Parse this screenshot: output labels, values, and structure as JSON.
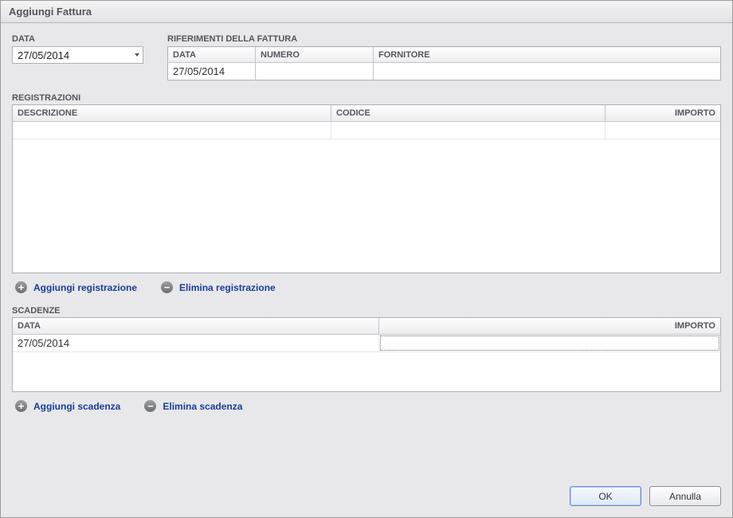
{
  "window": {
    "title": "Aggiungi Fattura"
  },
  "data_section": {
    "label": "DATA",
    "value": "27/05/2014"
  },
  "riferimenti": {
    "label": "RIFERIMENTI DELLA FATTURA",
    "columns": {
      "data": "DATA",
      "numero": "NUMERO",
      "fornitore": "FORNITORE"
    },
    "row": {
      "data": "27/05/2014",
      "numero": "",
      "fornitore": ""
    }
  },
  "registrazioni": {
    "label": "REGISTRAZIONI",
    "columns": {
      "descrizione": "DESCRIZIONE",
      "codice": "CODICE",
      "importo": "IMPORTO"
    },
    "rows": [
      {
        "descrizione": "",
        "codice": "",
        "importo": ""
      }
    ],
    "actions": {
      "add": "Aggiungi registrazione",
      "remove": "Elimina registrazione"
    }
  },
  "scadenze": {
    "label": "SCADENZE",
    "columns": {
      "data": "DATA",
      "importo": "IMPORTO"
    },
    "rows": [
      {
        "data": "27/05/2014",
        "importo": ""
      }
    ],
    "actions": {
      "add": "Aggiungi scadenza",
      "remove": "Elimina scadenza"
    }
  },
  "buttons": {
    "ok": "OK",
    "cancel": "Annulla"
  },
  "icons": {
    "plus": "+",
    "minus": "−"
  }
}
